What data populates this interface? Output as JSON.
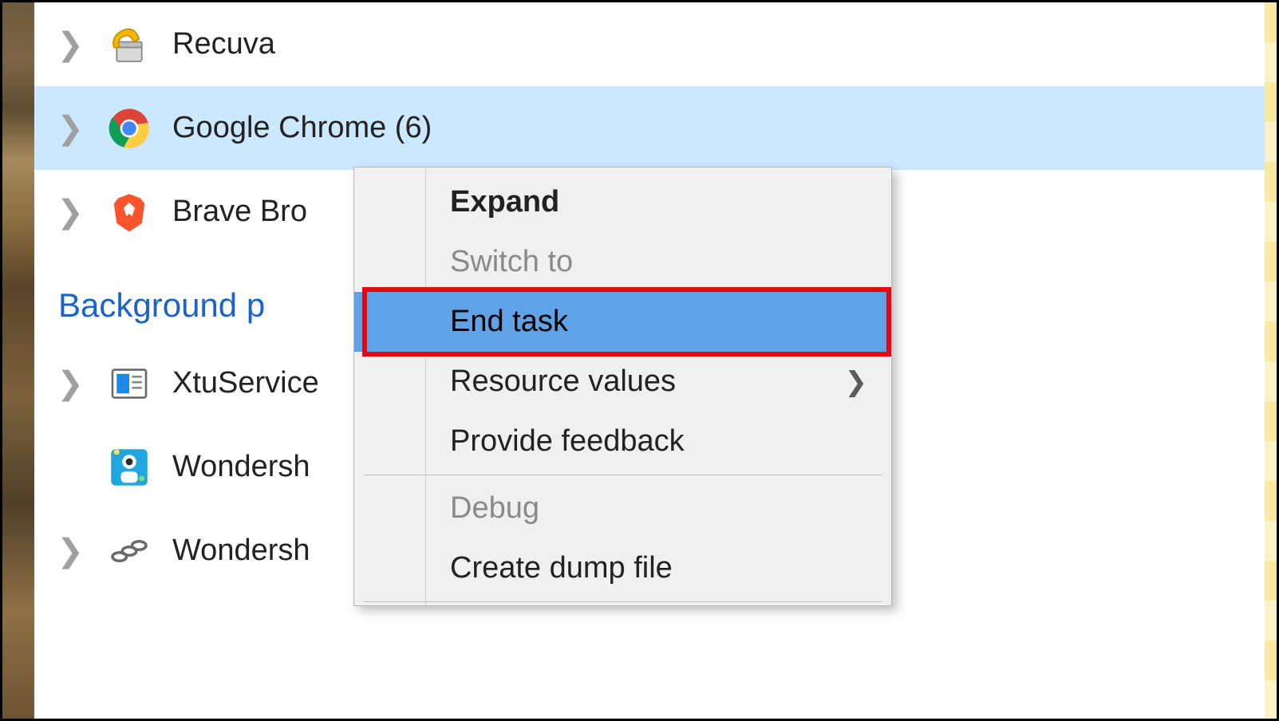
{
  "processes": [
    {
      "name": "Recuva",
      "selected": false,
      "has_chevron": true
    },
    {
      "name": "Google Chrome (6)",
      "selected": true,
      "has_chevron": true
    },
    {
      "name": "Brave Bro",
      "selected": false,
      "has_chevron": true
    }
  ],
  "section_header": "Background p",
  "background_processes": [
    {
      "name": "XtuService",
      "has_chevron": true
    },
    {
      "name": "Wondersh",
      "has_chevron": false
    },
    {
      "name": "Wondersh",
      "has_chevron": true
    }
  ],
  "context_menu": {
    "expand": "Expand",
    "switch_to": "Switch to",
    "end_task": "End task",
    "resource_values": "Resource values",
    "provide_feedback": "Provide feedback",
    "debug": "Debug",
    "create_dump": "Create dump file"
  }
}
